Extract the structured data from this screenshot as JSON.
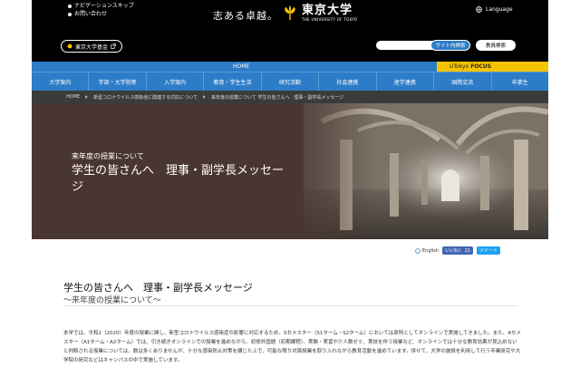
{
  "header": {
    "skip_nav": "ナビゲーションスキップ",
    "contact": "お問い合わせ",
    "motto": "志ある卓越。",
    "logo_jp": "東京大学",
    "logo_en": "THE UNIVERSITY OF TOKYO",
    "language": "Language",
    "fund_label": "東京大学基金",
    "search_placeholder": "",
    "search_button": "サイト内検索",
    "advanced_search": "教員検索"
  },
  "nav": {
    "home": "HOME",
    "focus_prefix": "UTokyo",
    "focus_label": "FOCUS",
    "items": [
      "大学案内",
      "学部・大学院等",
      "入学案内",
      "教育・学生生活",
      "研究活動",
      "社会連携",
      "産学連携",
      "国際交流",
      "卒業生"
    ]
  },
  "breadcrumb": [
    "HOME",
    "新型コロナウイルス感染症に関連する対応について",
    "来年度の授業について 学生の皆さんへ　理事・副学長メッセージ"
  ],
  "hero": {
    "subtitle": "来年度の授業について",
    "title": "学生の皆さんへ　理事・副学長メッセージ"
  },
  "social": {
    "english": "English",
    "like": "いいね！ 21",
    "tweet": "ツイート"
  },
  "article": {
    "title": "学生の皆さんへ　理事・副学長メッセージ",
    "subtitle": "～来年度の授業について～",
    "body": "本学では、令和2（2020）年度の授業に関し、新型コロナウイルス感染症の影響に対応するため、Sセメスター（S1ターム・S2ターム）においては原則としてオンラインで実施してきました。また、Aセメスター（A1ターム・A2ターム）では、引き続きオンラインでの授業を進めながら、初修外国語（初期課程）、実験・実習や少人数ゼミ、実技を伴う授業など、オンラインでは十分な教育効果が見込めないと判断される授業については、数は多くありませんが、十分な感染防止対策を講じた上で、可能な限り対面授業を取り入れながら教育活動を進めています。併せて、大学の施設を利用して行う卒業研究や大学院の研究などはキャンパスの中で実施しています。"
  },
  "colors": {
    "nav_blue": "#2d7cc7",
    "focus_yellow": "#f5c400",
    "hero_brown": "#4a3630"
  }
}
